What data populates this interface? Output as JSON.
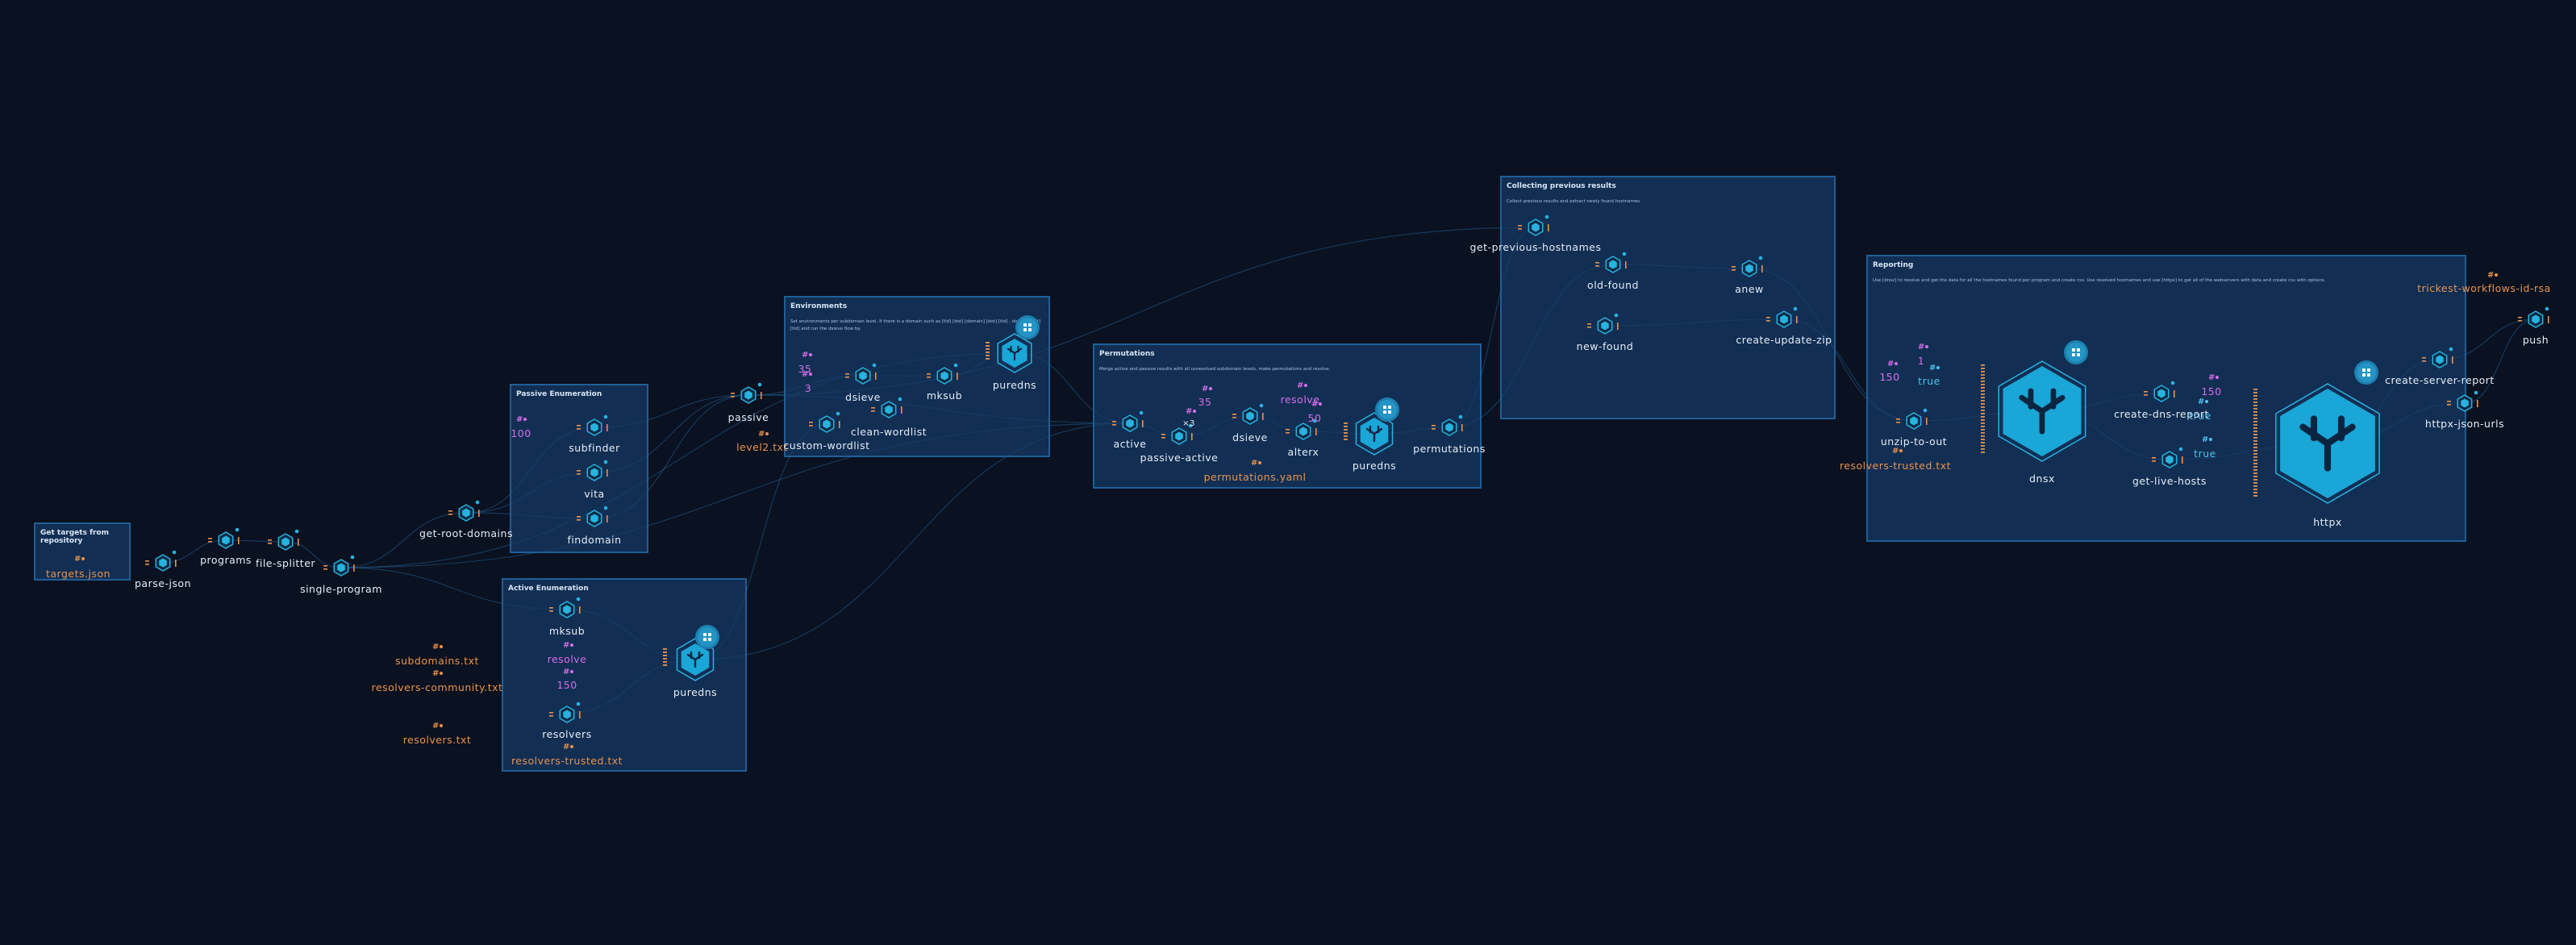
{
  "groups": {
    "get_targets": {
      "title": "Get targets from repository"
    },
    "passive": {
      "title": "Passive Enumeration"
    },
    "active": {
      "title": "Active Enumeration"
    },
    "environments": {
      "title": "Environments",
      "description": "Set environments per subdomain level. If there is a domain such as [tld] [dot] [domain] [dot] [tld] , domain [dot] [tld] and run the dsieve flow by."
    },
    "permutations": {
      "title": "Permutations",
      "description": "Merge active and passive results with all unresolved subdomain levels, make permutations and resolve."
    },
    "collecting": {
      "title": "Collecting previous results",
      "description": "Collect previous results and extract newly found hostnames"
    },
    "reporting": {
      "title": "Reporting",
      "description": "Use [dnsx] to resolve and get the data for all the hostnames found per program and create csv. Use resolved hostnames and use [httpx] to get all of the webservers with data and create csv with options."
    }
  },
  "nodes": {
    "targets_json": "targets.json",
    "parse_json": "parse-json",
    "programs": "programs",
    "file_splitter": "file-splitter",
    "single_program": "single-program",
    "get_root_domains": "get-root-domains",
    "subfinder": "subfinder",
    "vita": "vita",
    "findomain": "findomain",
    "passive_100": "100",
    "passive": "passive",
    "level2": "level2.txt",
    "mksub_active": "mksub",
    "resolve_active": "resolve",
    "active_150": "150",
    "resolvers": "resolvers",
    "resolvers_trusted_active": "resolvers-trusted.txt",
    "subdomains_txt": "subdomains.txt",
    "resolvers_community": "resolvers-community.txt",
    "resolvers_txt": "resolvers.txt",
    "puredns_active": "puredns",
    "env_35": "35",
    "env_3": "3",
    "dsieve_env": "dsieve",
    "mksub_env": "mksub",
    "puredns_env": "puredns",
    "clean_wordlist": "clean-wordlist",
    "custom_wordlist": "custom-wordlist",
    "active": "active",
    "passive_active": "passive-active",
    "perm_x3": "×3",
    "perm_35": "35",
    "dsieve_perm": "dsieve",
    "resolve_perm": "resolve",
    "perm_50": "50",
    "alterx": "alterx",
    "puredns_perm": "puredns",
    "permutations": "permutations",
    "permutations_yaml": "permutations.yaml",
    "get_previous_hostnames": "get-previous-hostnames",
    "old_found": "old-found",
    "new_found": "new-found",
    "anew": "anew",
    "create_update_zip": "create-update-zip",
    "rep_150a": "150",
    "rep_1": "1",
    "rep_true_a": "true",
    "unzip_to_out": "unzip-to-out",
    "resolvers_trusted_rep": "resolvers-trusted.txt",
    "dnsx": "dnsx",
    "create_dns_report": "create-dns-report",
    "rep_150b": "150",
    "rep_true_b": "true",
    "rep_true_c": "true",
    "get_live_hosts": "get-live-hosts",
    "httpx": "httpx",
    "create_server_report": "create-server-report",
    "httpx_json_urls": "httpx-json-urls",
    "trickest_id": "trickest-workflows-id-rsa",
    "push": "push"
  },
  "colors": {
    "background": "#0a1120",
    "group_fill": "#163a66",
    "group_border": "#1f5f97",
    "node_accent": "#27b3e0",
    "file_color": "#e8934d",
    "param_color": "#d66ee8",
    "bool_color": "#4fc3ea"
  },
  "icons": {
    "tool": "hexagon-tool-icon",
    "big_tool": "projectdiscovery-hexagon-icon",
    "file": "file-hash-icon",
    "param": "param-hash-icon",
    "node_add": "node-add-icon"
  }
}
